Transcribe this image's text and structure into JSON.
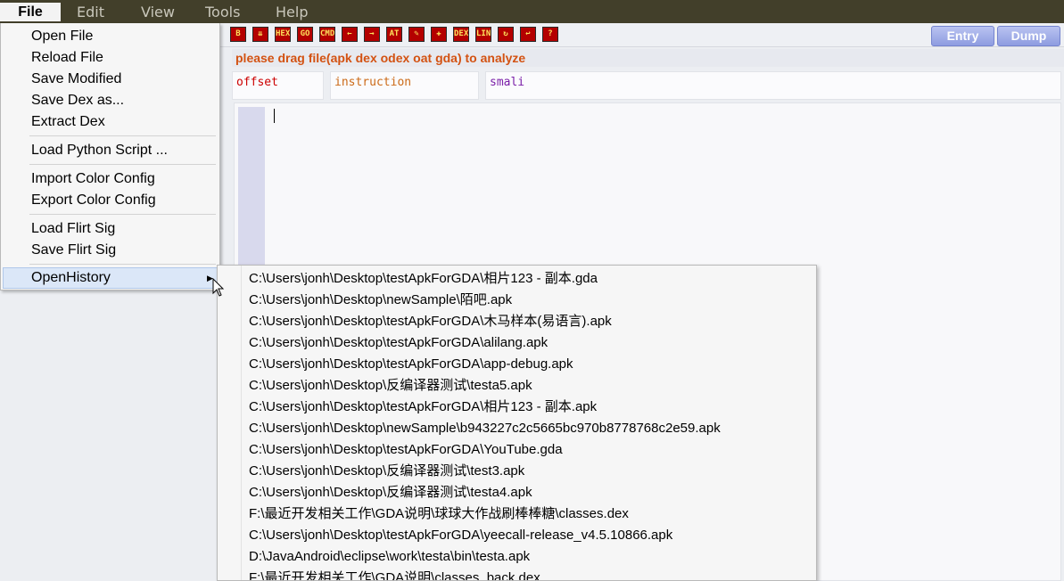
{
  "menubar": {
    "file": "File",
    "edit": "Edit",
    "view": "View",
    "tools": "Tools",
    "help": "Help"
  },
  "toolbar": {
    "icons": [
      "B",
      "⇊",
      "HEX",
      "GO",
      "CMD",
      "←",
      "→",
      "AT",
      "✎",
      "✚",
      "DEX",
      "LINE",
      "↻",
      "↩",
      "?"
    ],
    "entry": "Entry",
    "dump": "Dump"
  },
  "hint": "please drag file(apk dex odex oat gda) to analyze",
  "columns": {
    "offset": "offset",
    "instruction": "instruction",
    "smali": "smali"
  },
  "colors": {
    "offset": "#cc0000",
    "instruction": "#cc6a17",
    "smali": "#7a1fa8",
    "hint": "#d35212",
    "toolbar_icon": "#b40000"
  },
  "file_menu": {
    "items": [
      "Open File",
      "Reload File",
      "Save Modified",
      "Save Dex as...",
      "Extract Dex",
      "Load Python Script ...",
      "Import Color Config",
      "Export Color Config",
      "Load Flirt Sig",
      "Save Flirt Sig",
      "OpenHistory"
    ]
  },
  "history": [
    "C:\\Users\\jonh\\Desktop\\testApkForGDA\\相片123 - 副本.gda",
    "C:\\Users\\jonh\\Desktop\\newSample\\陌吧.apk",
    "C:\\Users\\jonh\\Desktop\\testApkForGDA\\木马样本(易语言).apk",
    "C:\\Users\\jonh\\Desktop\\testApkForGDA\\alilang.apk",
    "C:\\Users\\jonh\\Desktop\\testApkForGDA\\app-debug.apk",
    "C:\\Users\\jonh\\Desktop\\反编译器测试\\testa5.apk",
    "C:\\Users\\jonh\\Desktop\\testApkForGDA\\相片123 - 副本.apk",
    "C:\\Users\\jonh\\Desktop\\newSample\\b943227c2c5665bc970b8778768c2e59.apk",
    "C:\\Users\\jonh\\Desktop\\testApkForGDA\\YouTube.gda",
    "C:\\Users\\jonh\\Desktop\\反编译器测试\\test3.apk",
    "C:\\Users\\jonh\\Desktop\\反编译器测试\\testa4.apk",
    "F:\\最近开发相关工作\\GDA说明\\球球大作战刷棒棒糖\\classes.dex",
    "C:\\Users\\jonh\\Desktop\\testApkForGDA\\yeecall-release_v4.5.10866.apk",
    "D:\\JavaAndroid\\eclipse\\work\\testa\\bin\\testa.apk",
    "F:\\最近开发相关工作\\GDA说明\\classes_back.dex"
  ]
}
